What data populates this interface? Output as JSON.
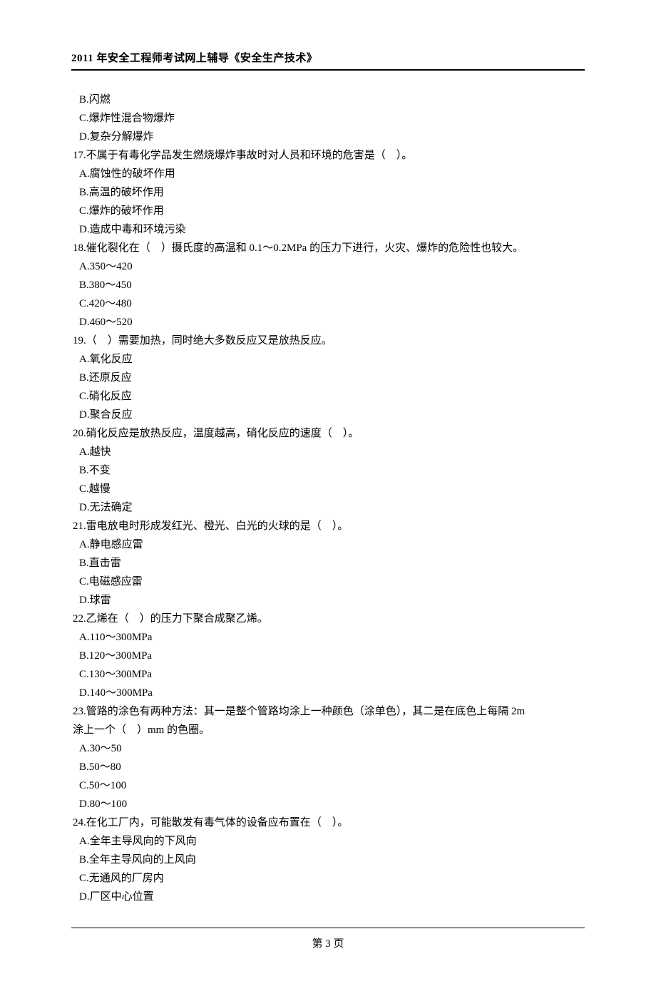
{
  "header": "2011 年安全工程师考试网上辅导《安全生产技术》",
  "footer": "第 3 页",
  "items": [
    {
      "cls": "opt",
      "text": "B.闪燃"
    },
    {
      "cls": "opt",
      "text": "C.爆炸性混合物爆炸"
    },
    {
      "cls": "opt",
      "text": "D.复杂分解爆炸"
    },
    {
      "cls": "q",
      "text": "17.不属于有毒化学品发生燃烧爆炸事故时对人员和环境的危害是（　）。"
    },
    {
      "cls": "opt",
      "text": "A.腐蚀性的破坏作用"
    },
    {
      "cls": "opt",
      "text": "B.高温的破坏作用"
    },
    {
      "cls": "opt",
      "text": "C.爆炸的破坏作用"
    },
    {
      "cls": "opt",
      "text": "D.造成中毒和环境污染"
    },
    {
      "cls": "q",
      "text": "18.催化裂化在（　）摄氏度的高温和 0.1～0.2MPa 的压力下进行，火灾、爆炸的危险性也较大。"
    },
    {
      "cls": "opt",
      "text": "A.350～420"
    },
    {
      "cls": "opt",
      "text": "B.380～450"
    },
    {
      "cls": "opt",
      "text": "C.420～480"
    },
    {
      "cls": "opt",
      "text": "D.460～520"
    },
    {
      "cls": "q",
      "text": "19.（　）需要加热，同时绝大多数反应又是放热反应。"
    },
    {
      "cls": "opt",
      "text": "A.氧化反应"
    },
    {
      "cls": "opt",
      "text": "B.还原反应"
    },
    {
      "cls": "opt",
      "text": "C.硝化反应"
    },
    {
      "cls": "opt",
      "text": "D.聚合反应"
    },
    {
      "cls": "q",
      "text": "20.硝化反应是放热反应，温度越高，硝化反应的速度（　）。"
    },
    {
      "cls": "opt",
      "text": "A.越快"
    },
    {
      "cls": "opt",
      "text": "B.不变"
    },
    {
      "cls": "opt",
      "text": "C.越慢"
    },
    {
      "cls": "opt",
      "text": "D.无法确定"
    },
    {
      "cls": "q",
      "text": "21.雷电放电时形成发红光、橙光、白光的火球的是（　）。"
    },
    {
      "cls": "opt",
      "text": "A.静电感应雷"
    },
    {
      "cls": "opt",
      "text": "B.直击雷"
    },
    {
      "cls": "opt",
      "text": "C.电磁感应雷"
    },
    {
      "cls": "opt",
      "text": "D.球雷"
    },
    {
      "cls": "q",
      "text": "22.乙烯在（　）的压力下聚合成聚乙烯。"
    },
    {
      "cls": "opt",
      "text": "A.110～300MPa"
    },
    {
      "cls": "opt",
      "text": "B.120～300MPa"
    },
    {
      "cls": "opt",
      "text": "C.130～300MPa"
    },
    {
      "cls": "opt",
      "text": "D.140～300MPa"
    },
    {
      "cls": "q",
      "text": "23.管路的涂色有两种方法：其一是整个管路均涂上一种颜色（涂单色），其二是在底色上每隔 2m"
    },
    {
      "cls": "q",
      "text": "涂上一个（　）mm 的色圈。"
    },
    {
      "cls": "opt",
      "text": "A.30～50"
    },
    {
      "cls": "opt",
      "text": "B.50～80"
    },
    {
      "cls": "opt",
      "text": "C.50～100"
    },
    {
      "cls": "opt",
      "text": "D.80～100"
    },
    {
      "cls": "q",
      "text": "24.在化工厂内，可能散发有毒气体的设备应布置在（　）。"
    },
    {
      "cls": "opt",
      "text": "A.全年主导风向的下风向"
    },
    {
      "cls": "opt",
      "text": "B.全年主导风向的上风向"
    },
    {
      "cls": "opt",
      "text": "C.无通风的厂房内"
    },
    {
      "cls": "opt",
      "text": "D.厂区中心位置"
    }
  ]
}
